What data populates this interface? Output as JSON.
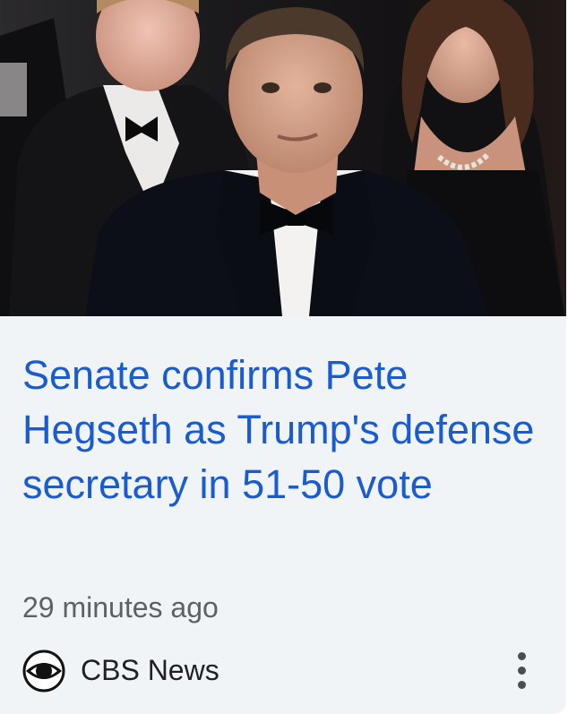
{
  "article": {
    "image_alt": "",
    "headline": "Senate confirms Pete Hegseth as Trump's defense secretary in 51-50 vote",
    "timestamp": "29 minutes ago",
    "source": {
      "name": "CBS News",
      "logo_icon": "cbs-eye-icon"
    },
    "more_icon": "more-vertical-icon"
  },
  "colors": {
    "headline": "#1a5cd0",
    "card_background": "#f1f4f6",
    "meta_text": "#5d6166",
    "source_text": "#202124"
  }
}
